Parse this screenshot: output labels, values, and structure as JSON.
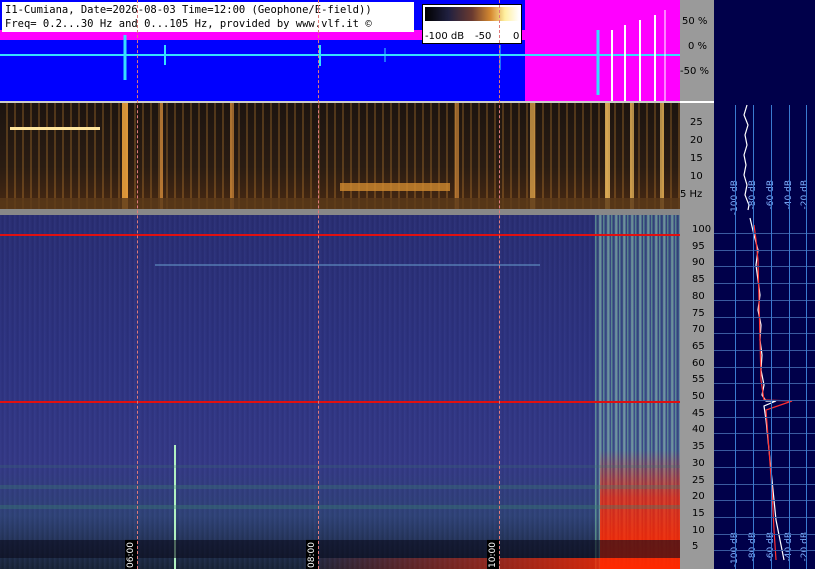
{
  "header": {
    "line1": "I1-Cumiana, Date=2026-08-03 Time=12:00 (Geophone/E-field))",
    "line2": "Freq= 0.2...30 Hz and 0...105 Hz, provided by www.vlf.it ©"
  },
  "colorbar": {
    "labels": [
      "-100 dB",
      "-50",
      "0"
    ]
  },
  "wave_scale": {
    "ticks": [
      "50 %",
      "0 %",
      "-50 %"
    ]
  },
  "spec_low_scale": {
    "ticks": [
      "25",
      "20",
      "15",
      "10",
      "5 Hz"
    ]
  },
  "spec_high_scale": {
    "ticks": [
      "100",
      "95",
      "90",
      "85",
      "80",
      "75",
      "70",
      "65",
      "60",
      "55",
      "50",
      "45",
      "40",
      "35",
      "30",
      "25",
      "20",
      "15",
      "10",
      "5"
    ]
  },
  "time_markers": [
    "06:00",
    "08:00",
    "10:00"
  ],
  "profile_top_labels": [
    "-100 dB",
    "-80 dB",
    "-60 dB",
    "-40 dB",
    "-20 dB"
  ],
  "profile_bottom_labels": [
    "-100 dB",
    "-80 dB",
    "-60 dB",
    "-40 dB",
    "-20 dB"
  ],
  "colors": {
    "wave_bg": "#0000ff",
    "wave_clip": "#ff00ff",
    "line_marker": "#e01010",
    "profile_bg": "#00004a",
    "profile_grid": "#3a7ad0"
  }
}
